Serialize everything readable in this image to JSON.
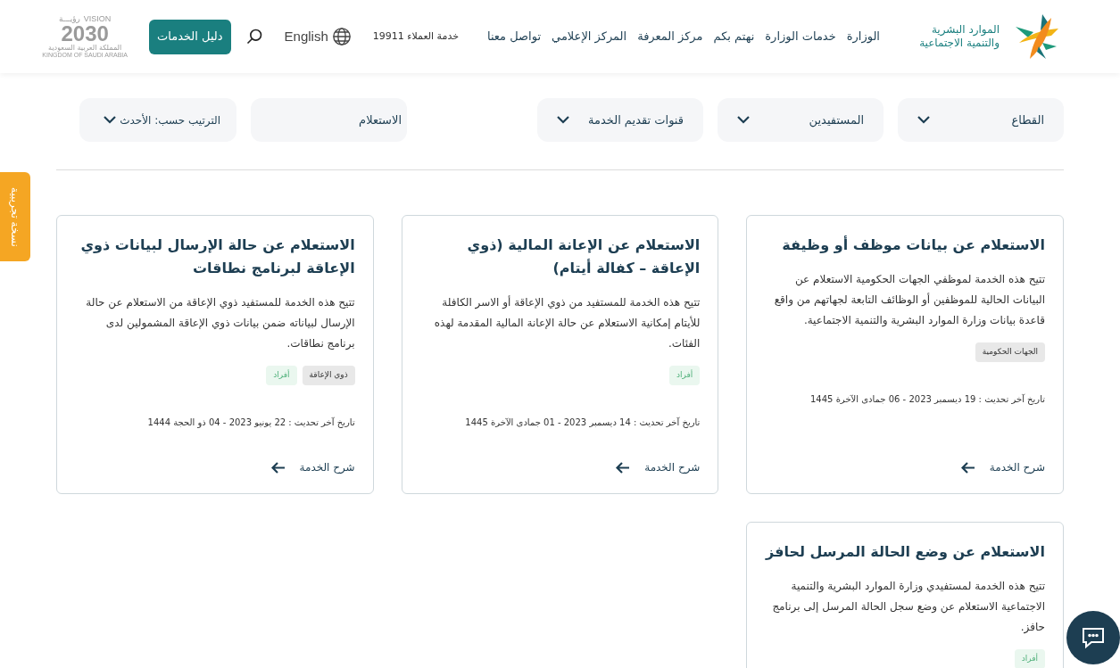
{
  "header": {
    "logo_text": "الموارد البشرية والتنمية الاجتماعية",
    "nav": [
      {
        "label": "الوزارة"
      },
      {
        "label": "خدمات الوزارة"
      },
      {
        "label": "نهتم بكم"
      },
      {
        "label": "مركز المعرفة"
      },
      {
        "label": "المركز الإعلامي"
      },
      {
        "label": "تواصل معنا"
      }
    ],
    "customer_service": "خدمة العملاء 19911",
    "language": "English",
    "guide_button": "دليل الخدمات",
    "vision": {
      "title": "VISION",
      "arabic": "رؤيـــة",
      "year": "2030",
      "subtitle": "المملكة العربية السعودية",
      "subtitle_en": "KINGDOM OF SAUDI ARABIA"
    }
  },
  "filters": [
    {
      "kind": "dropdown",
      "label": "القطاع"
    },
    {
      "kind": "dropdown",
      "label": "المستفيدين"
    },
    {
      "kind": "dropdown",
      "label": "قنوات تقديم الخدمة"
    },
    {
      "kind": "search",
      "value": "الاستعلام"
    },
    {
      "kind": "sort",
      "label": "الترتيب حسب: الأحدث"
    }
  ],
  "beta_tab": "نسخة تجريبية",
  "cards": [
    {
      "title": "الاستعلام عن بيانات موظف أو وظيفة",
      "description": "تتيح هذه الخدمة لموظفي الجهات الحكومية الاستعلام عن البيانات الحالية للموظفين أو الوظائف التابعة لجهاتهم من واقع قاعدة بيانات وزارة الموارد البشرية والتنمية الاجتماعية.",
      "tags": [
        {
          "label": "الجهات الحكومية",
          "kind": "grey"
        }
      ],
      "updated": "تاريخ آخر تحديث : 19 ديسمبر 2023 - 06 جمادى الآخرة 1445",
      "link": "شرح الخدمة"
    },
    {
      "title": "الاستعلام عن الإعانة المالية (ذوي الإعاقة – كفالة أيتام)",
      "description": "تتيح هذه الخدمة للمستفيد من ذوي الإعاقة أو الاسر الكافلة للأيتام إمكانية الاستعلام عن حالة الإعانة المالية المقدمة لهذه الفئات.",
      "tags": [
        {
          "label": "أفراد",
          "kind": "green"
        }
      ],
      "updated": "تاريخ آخر تحديث : 14 ديسمبر 2023 - 01 جمادى الآخرة 1445",
      "link": "شرح الخدمة"
    },
    {
      "title": "الاستعلام عن حالة الإرسال لبيانات ذوي الإعاقة لبرنامج نطاقات",
      "description": "تتيح هذه الخدمة للمستفيد ذوي الإعاقة من الاستعلام عن حالة الإرسال لبياناته ضمن بيانات ذوي الإعاقة المشمولين لدى برنامج نطاقات.",
      "tags": [
        {
          "label": "ذوي الإعاقة",
          "kind": "grey"
        },
        {
          "label": "أفراد",
          "kind": "green"
        }
      ],
      "updated": "تاريخ آخر تحديث : 22 يونيو 2023 - 04 ذو الحجة 1444",
      "link": "شرح الخدمة"
    },
    {
      "title": "الاستعلام عن وضع الحالة المرسل لحافز",
      "description": "تتيح هذه الخدمة لمستفيدي وزارة الموارد البشرية والتنمية الاجتماعية الاستعلام عن وضع سجل الحالة المرسل إلى برنامج حافز.",
      "tags": [
        {
          "label": "أفراد",
          "kind": "green"
        }
      ]
    }
  ]
}
